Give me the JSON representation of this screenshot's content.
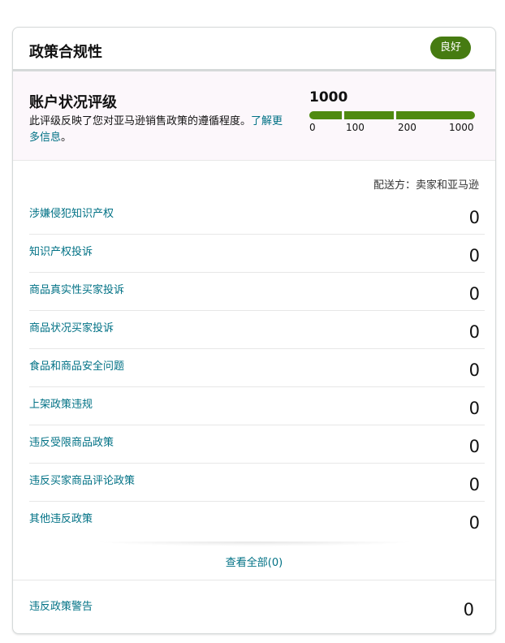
{
  "card": {
    "title": "政策合规性",
    "status_badge": "良好",
    "status_color": "#467b11"
  },
  "account_health": {
    "title": "账户状况评级",
    "description": "此评级反映了您对亚马逊销售政策的遵循程度。",
    "learn_more": "了解更多信息",
    "description_end": "。",
    "score": "1000",
    "score_value": 1000,
    "bar_color": "#4f8a10",
    "ticks": [
      "0",
      "100",
      "200",
      "1000"
    ]
  },
  "fulfilled_by": "配送方：卖家和亚马逊",
  "metrics": [
    {
      "label": "涉嫌侵犯知识产权",
      "count": "0"
    },
    {
      "label": "知识产权投诉",
      "count": "0"
    },
    {
      "label": "商品真实性买家投诉",
      "count": "0"
    },
    {
      "label": "商品状况买家投诉",
      "count": "0"
    },
    {
      "label": "食品和商品安全问题",
      "count": "0"
    },
    {
      "label": "上架政策违规",
      "count": "0"
    },
    {
      "label": "违反受限商品政策",
      "count": "0"
    },
    {
      "label": "违反买家商品评论政策",
      "count": "0"
    },
    {
      "label": "其他违反政策",
      "count": "0"
    }
  ],
  "view_all": "查看全部(0)",
  "policy_warnings": {
    "label": "违反政策警告",
    "count": "0"
  }
}
